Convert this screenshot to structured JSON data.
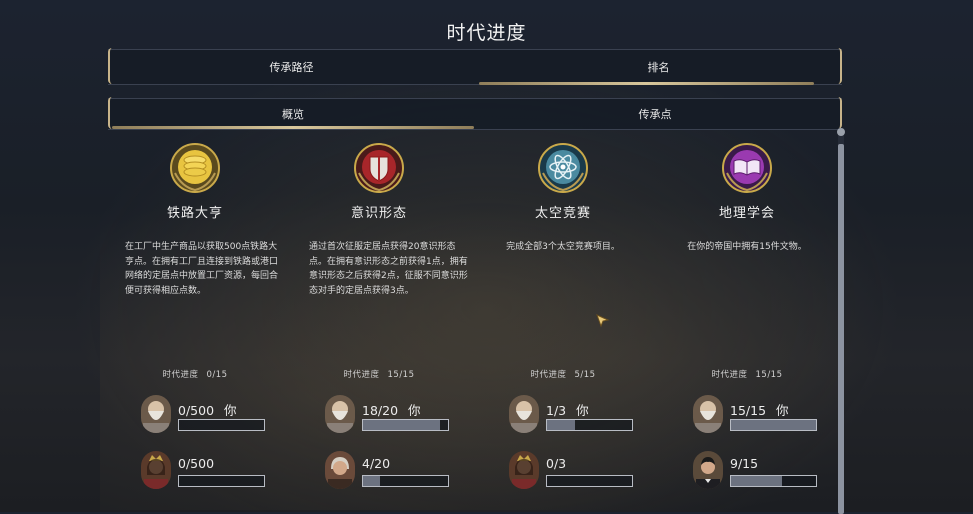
{
  "page_title": "时代进度",
  "top_tabs": [
    {
      "label": "传承路径",
      "active": false
    },
    {
      "label": "排名",
      "active": true
    }
  ],
  "sub_tabs": [
    {
      "label": "概览",
      "active": true
    },
    {
      "label": "传承点",
      "active": false
    }
  ],
  "columns": [
    {
      "icon": "gold-coins-icon",
      "title": "铁路大亨",
      "description": "在工厂中生产商品以获取500点铁路大亨点。在拥有工厂且连接到铁路或港口网络的定居点中放置工厂资源，每回合便可获得相应点数。",
      "progress_label": "时代进度",
      "progress_value": "0/15",
      "rows": [
        {
          "portrait": "bearded-leader-portrait",
          "score": "0/500",
          "tag": "你",
          "fill": 0
        },
        {
          "portrait": "crowned-queen-portrait",
          "score": "0/500",
          "tag": "",
          "fill": 0
        }
      ]
    },
    {
      "icon": "shield-emblem-icon",
      "title": "意识形态",
      "description": "通过首次征服定居点获得20意识形态点。在拥有意识形态之前获得1点，拥有意识形态之后获得2点，征服不同意识形态对手的定居点获得3点。",
      "progress_label": "时代进度",
      "progress_value": "15/15",
      "rows": [
        {
          "portrait": "bearded-leader-portrait",
          "score": "18/20",
          "tag": "你",
          "fill": 0.9
        },
        {
          "portrait": "colonial-statesman-portrait",
          "score": "4/20",
          "tag": "",
          "fill": 0.2
        }
      ]
    },
    {
      "icon": "atom-icon",
      "title": "太空竞赛",
      "description": "完成全部3个太空竞赛项目。",
      "progress_label": "时代进度",
      "progress_value": "5/15",
      "rows": [
        {
          "portrait": "bearded-leader-portrait",
          "score": "1/3",
          "tag": "你",
          "fill": 0.3333
        },
        {
          "portrait": "crowned-queen-portrait",
          "score": "0/3",
          "tag": "",
          "fill": 0
        }
      ]
    },
    {
      "icon": "open-book-icon",
      "title": "地理学会",
      "description": "在你的帝国中拥有15件文物。",
      "progress_label": "时代进度",
      "progress_value": "15/15",
      "rows": [
        {
          "portrait": "bearded-leader-portrait",
          "score": "15/15",
          "tag": "你",
          "fill": 1
        },
        {
          "portrait": "young-leader-portrait",
          "score": "9/15",
          "tag": "",
          "fill": 0.6
        }
      ]
    }
  ],
  "colors": {
    "gold_accent": "#c8b48a",
    "bar_fill": "#6c7280",
    "bar_border": "#b8bcc4"
  }
}
